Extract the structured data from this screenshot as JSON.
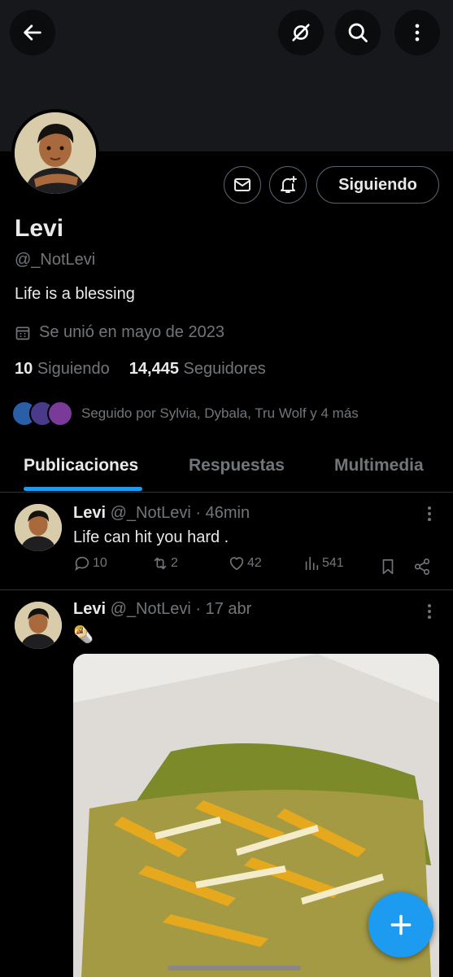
{
  "profile": {
    "name": "Levi",
    "handle": "@_NotLevi",
    "bio": "Life is a blessing",
    "joined": "Se unió en mayo de 2023",
    "following_count": "10",
    "following_label": "Siguiendo",
    "followers_count": "14,445",
    "followers_label": "Seguidores",
    "followed_by": "Seguido por Sylvia, Dybala, Tru Wolf y 4 más",
    "following_button": "Siguiendo"
  },
  "tabs": [
    {
      "label": "Publicaciones",
      "active": true
    },
    {
      "label": "Respuestas",
      "active": false
    },
    {
      "label": "Multimedia",
      "active": false
    }
  ],
  "posts": [
    {
      "name": "Levi",
      "handle": "@_NotLevi",
      "time": "· 46min",
      "text": "Life can hit you hard .",
      "replies": "10",
      "reposts": "2",
      "likes": "42",
      "views": "541"
    },
    {
      "name": "Levi",
      "handle": "@_NotLevi",
      "time": "· 17 abr",
      "text": "🌯"
    }
  ],
  "icons": {
    "back": "arrow-left-icon",
    "grok": "grok-icon",
    "search": "search-icon",
    "more": "more-vertical-icon",
    "message": "mail-icon",
    "notify": "bell-plus-icon",
    "calendar": "calendar-icon",
    "compose": "plus-icon"
  },
  "colors": {
    "accent": "#1d9bf0",
    "background": "#000000",
    "muted": "#71767b"
  }
}
